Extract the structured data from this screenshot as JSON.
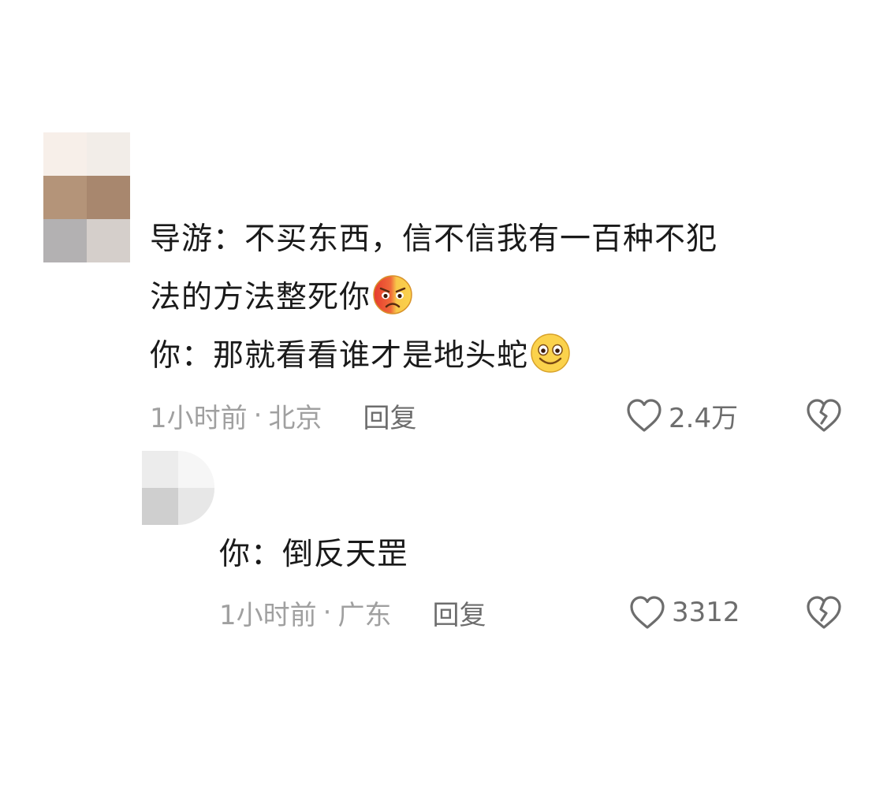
{
  "main_comment": {
    "lines": [
      "导游：不买东西，信不信我有一百种不犯",
      "法的方法整死你",
      "你：那就看看谁才是地头蛇"
    ],
    "emoji_line2": "angry-sad-face-icon",
    "emoji_line3": "smiling-face-icon",
    "time": "1小时前",
    "separator": "·",
    "location": "北京",
    "reply_label": "回复",
    "like_count": "2.4万"
  },
  "reply_comment": {
    "text": "你：倒反天罡",
    "time": "1小时前",
    "separator": "·",
    "location": "广东",
    "reply_label": "回复",
    "like_count": "3312"
  },
  "colors": {
    "text": "#1a1a1a",
    "meta": "#a0a0a0",
    "action": "#6d6d6d",
    "background": "#ffffff"
  }
}
